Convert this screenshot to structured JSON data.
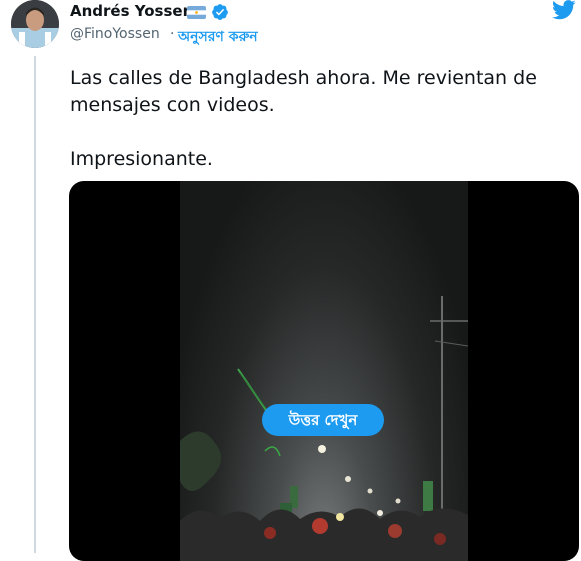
{
  "author": {
    "name": "Andrés Yossen",
    "handle": "@FinoYossen",
    "separator": "·",
    "follow_label": "অনুসরণ করুন",
    "flag": "argentina-flag-icon",
    "verified": "verified-badge-icon"
  },
  "tweet": {
    "paragraph_1": "Las calles de Bangladesh ahora. Me revientan de mensajes con videos.",
    "paragraph_2": "Impresionante."
  },
  "media": {
    "type": "video",
    "overlay_button_label": "উত্তর দেখুন"
  },
  "colors": {
    "accent": "#1d9bf0",
    "text": "#0f1419",
    "muted": "#536471",
    "thread_line": "#cfd9de"
  }
}
